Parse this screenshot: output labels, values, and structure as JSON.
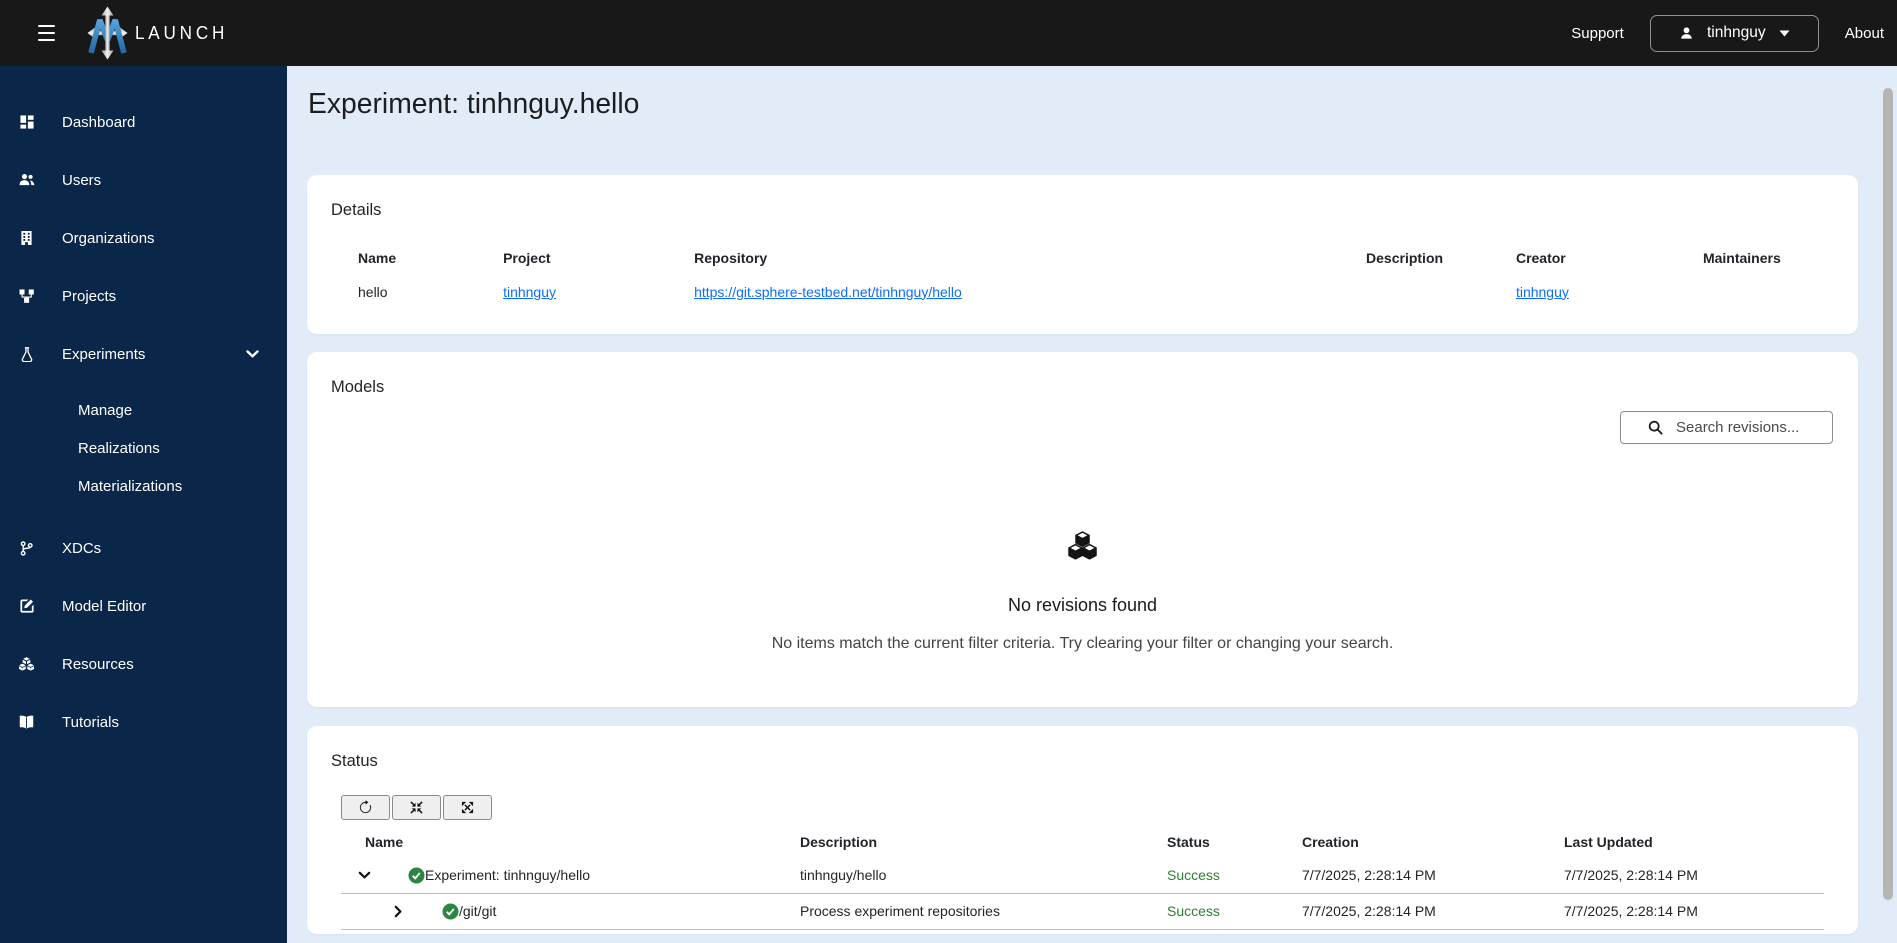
{
  "header": {
    "brand": "LAUNCH",
    "support_label": "Support",
    "about_label": "About",
    "user_name": "tinhnguy"
  },
  "sidebar": {
    "items": [
      {
        "label": "Dashboard",
        "icon": "dashboard-icon"
      },
      {
        "label": "Users",
        "icon": "users-icon"
      },
      {
        "label": "Organizations",
        "icon": "building-icon"
      },
      {
        "label": "Projects",
        "icon": "diagram-icon"
      },
      {
        "label": "Experiments",
        "icon": "flask-icon",
        "expanded": true
      },
      {
        "label": "Manage",
        "sub_item_of": "Experiments"
      },
      {
        "label": "Realizations",
        "sub_item_of": "Experiments"
      },
      {
        "label": "Materializations",
        "sub_item_of": "Experiments"
      },
      {
        "label": "XDCs",
        "icon": "git-branch-icon"
      },
      {
        "label": "Model Editor",
        "icon": "pencil-square-icon"
      },
      {
        "label": "Resources",
        "icon": "boxes-icon"
      },
      {
        "label": "Tutorials",
        "icon": "book-icon"
      }
    ]
  },
  "page": {
    "title": "Experiment: tinhnguy.hello"
  },
  "details": {
    "title": "Details",
    "columns": [
      "Name",
      "Project",
      "Repository",
      "Description",
      "Creator",
      "Maintainers"
    ],
    "row": {
      "name": "hello",
      "project": "tinhnguy",
      "repository": "https://git.sphere-testbed.net/tinhnguy/hello",
      "description": "",
      "creator": "tinhnguy",
      "maintainers": ""
    }
  },
  "models": {
    "title": "Models",
    "search_placeholder": "Search revisions...",
    "empty_heading": "No revisions found",
    "empty_message": "No items match the current filter criteria. Try clearing your filter or changing your search."
  },
  "status": {
    "title": "Status",
    "toolbar_icons": [
      "refresh-icon",
      "collapse-icon",
      "expand-icon"
    ],
    "columns": [
      "Name",
      "Description",
      "Status",
      "Creation",
      "Last Updated"
    ],
    "rows": [
      {
        "name": "Experiment: tinhnguy/hello",
        "description": "tinhnguy/hello",
        "status": "Success",
        "creation": "7/7/2025, 2:28:14 PM",
        "last_updated": "7/7/2025, 2:28:14 PM",
        "level": 0,
        "expanded": true
      },
      {
        "name": "/git/git",
        "description": "Process experiment repositories",
        "status": "Success",
        "creation": "7/7/2025, 2:28:14 PM",
        "last_updated": "7/7/2025, 2:28:14 PM",
        "level": 1,
        "expanded": false
      }
    ]
  },
  "colors": {
    "header_bg": "#181818",
    "sidebar_bg": "#0a2649",
    "page_bg": "#e2ecf8",
    "link": "#0d6efd",
    "success_text": "#2e7d32",
    "check_green": "#2e8540",
    "logo_blue": "#2d7dc2"
  }
}
